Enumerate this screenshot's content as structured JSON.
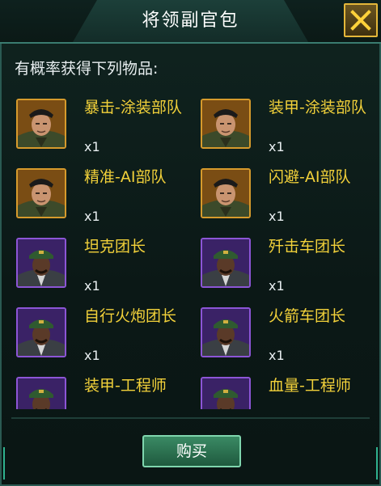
{
  "header": {
    "title": "将领副官包"
  },
  "subtitle": "有概率获得下列物品:",
  "items": [
    {
      "name": "暴击-涂装部队",
      "qty": "x1",
      "frame": "gold"
    },
    {
      "name": "装甲-涂装部队",
      "qty": "x1",
      "frame": "gold"
    },
    {
      "name": "精准-AI部队",
      "qty": "x1",
      "frame": "gold"
    },
    {
      "name": "闪避-AI部队",
      "qty": "x1",
      "frame": "gold"
    },
    {
      "name": "坦克团长",
      "qty": "x1",
      "frame": "purple"
    },
    {
      "name": "歼击车团长",
      "qty": "x1",
      "frame": "purple"
    },
    {
      "name": "自行火炮团长",
      "qty": "x1",
      "frame": "purple"
    },
    {
      "name": "火箭车团长",
      "qty": "x1",
      "frame": "purple"
    },
    {
      "name": "装甲-工程师",
      "qty": "",
      "frame": "purple"
    },
    {
      "name": "血量-工程师",
      "qty": "",
      "frame": "purple"
    }
  ],
  "buy_label": "购买",
  "colors": {
    "item_name": "#f2d13a",
    "gold_frame": "#d69a2c",
    "purple_frame": "#8c55d6",
    "buy_button": "#2e7a56"
  },
  "icons": {
    "close": "close-icon"
  }
}
